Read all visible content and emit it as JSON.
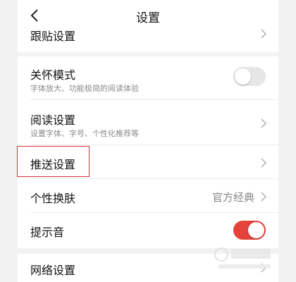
{
  "header": {
    "title": "设置",
    "back_icon": "chevron-left-icon"
  },
  "rows": {
    "paste": {
      "label": "跟贴设置"
    },
    "care_mode": {
      "label": "关怀模式",
      "subtitle": "字体放大、功能极简的阅读体验",
      "enabled": false
    },
    "reading": {
      "label": "阅读设置",
      "subtitle": "设置字体、字号、个性化推荐等"
    },
    "push": {
      "label": "推送设置"
    },
    "skin": {
      "label": "个性换肤",
      "value": "官方经典"
    },
    "sound": {
      "label": "提示音",
      "enabled": true
    },
    "network": {
      "label": "网络设置"
    }
  },
  "colors": {
    "accent": "#e5423a",
    "highlight_border": "#d3323a",
    "toggle_off": "#e6e6e6"
  }
}
